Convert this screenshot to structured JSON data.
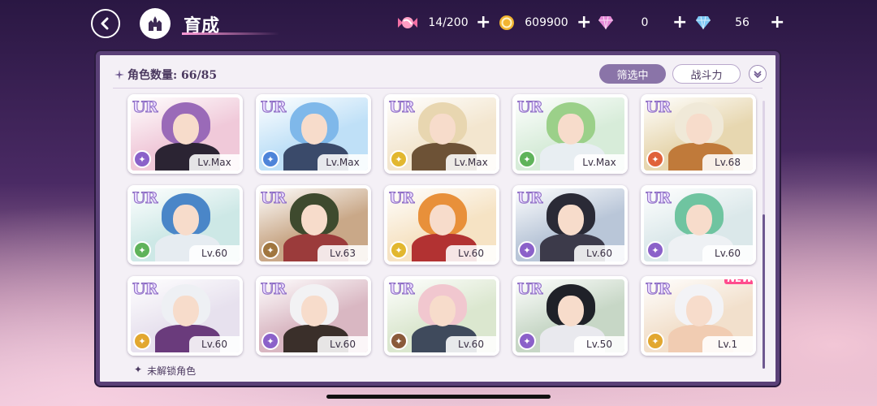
{
  "header": {
    "title": "育成",
    "resources": [
      {
        "name": "candy",
        "icon": "candy-icon",
        "value": "14/200",
        "color": "#f36fa4"
      },
      {
        "name": "coin",
        "icon": "coin-icon",
        "value": "609900",
        "color": "#f2b531"
      },
      {
        "name": "pink-gem",
        "icon": "pink-diamond-icon",
        "value": "0",
        "color": "#e68ad8"
      },
      {
        "name": "blue-gem",
        "icon": "blue-diamond-icon",
        "value": "56",
        "color": "#7cc8f4"
      }
    ],
    "plus_label": "+"
  },
  "panel": {
    "count_label": "角色数量: 66/85",
    "filter_label": "筛选中",
    "sort_label": "战斗力",
    "locked_label": "未解锁角色",
    "locked_star": "✦"
  },
  "cards": [
    {
      "rarity": "UR",
      "level": "Lv.Max",
      "attr_color": "#8b61c9",
      "hair": "#9a6ab8",
      "outfit": "#2b2433",
      "bg": "#f0c9d9"
    },
    {
      "rarity": "UR",
      "level": "Lv.Max",
      "attr_color": "#4e84d9",
      "hair": "#7fb8ea",
      "outfit": "#3a4a6a",
      "bg": "#bfe0f7"
    },
    {
      "rarity": "UR",
      "level": "Lv.Max",
      "attr_color": "#e2b72f",
      "hair": "#e8d6b0",
      "outfit": "#6d5236",
      "bg": "#f3e6cf"
    },
    {
      "rarity": "UR",
      "level": "Lv.Max",
      "attr_color": "#5fb35a",
      "hair": "#9bd089",
      "outfit": "#e8eef2",
      "bg": "#d7ecd9"
    },
    {
      "rarity": "UR",
      "level": "Lv.68",
      "attr_color": "#e0623a",
      "hair": "#f0e9d8",
      "outfit": "#c07a3a",
      "bg": "#e7d7b0"
    },
    {
      "rarity": "UR",
      "level": "Lv.60",
      "attr_color": "#5fb35a",
      "hair": "#4a86c8",
      "outfit": "#e6ecf1",
      "bg": "#cde8e6"
    },
    {
      "rarity": "UR",
      "level": "Lv.63",
      "attr_color": "#a0763f",
      "hair": "#3e4a2e",
      "outfit": "#9b3b3b",
      "bg": "#c9a888"
    },
    {
      "rarity": "UR",
      "level": "Lv.60",
      "attr_color": "#e2b72f",
      "hair": "#e8903a",
      "outfit": "#b23232",
      "bg": "#f6e3c4"
    },
    {
      "rarity": "UR",
      "level": "Lv.60",
      "attr_color": "#8b61c9",
      "hair": "#2a2a36",
      "outfit": "#3c3a4a",
      "bg": "#b9c6d8"
    },
    {
      "rarity": "UR",
      "level": "Lv.60",
      "attr_color": "#8b61c9",
      "hair": "#6fc4a0",
      "outfit": "#eef1f4",
      "bg": "#dbe8ea"
    },
    {
      "rarity": "UR",
      "level": "Lv.60",
      "attr_color": "#e2a72f",
      "hair": "#eef0f4",
      "outfit": "#6a3b7c",
      "bg": "#e7e1ee"
    },
    {
      "rarity": "UR",
      "level": "Lv.60",
      "attr_color": "#8b61c9",
      "hair": "#f2f2f4",
      "outfit": "#3a2f2a",
      "bg": "#d9b7c2"
    },
    {
      "rarity": "UR",
      "level": "Lv.60",
      "attr_color": "#8a5a3a",
      "hair": "#f1c7cf",
      "outfit": "#3f4a5c",
      "bg": "#dbe7cf"
    },
    {
      "rarity": "UR",
      "level": "Lv.50",
      "attr_color": "#8b61c9",
      "hair": "#1f2128",
      "outfit": "#e9e9ee",
      "bg": "#c7d7c6"
    },
    {
      "rarity": "UR",
      "level": "Lv.1",
      "attr_color": "#e2a72f",
      "hair": "#f3f3f6",
      "outfit": "#f1ccb2",
      "bg": "#f2e0cc",
      "badge": "NEW"
    }
  ]
}
